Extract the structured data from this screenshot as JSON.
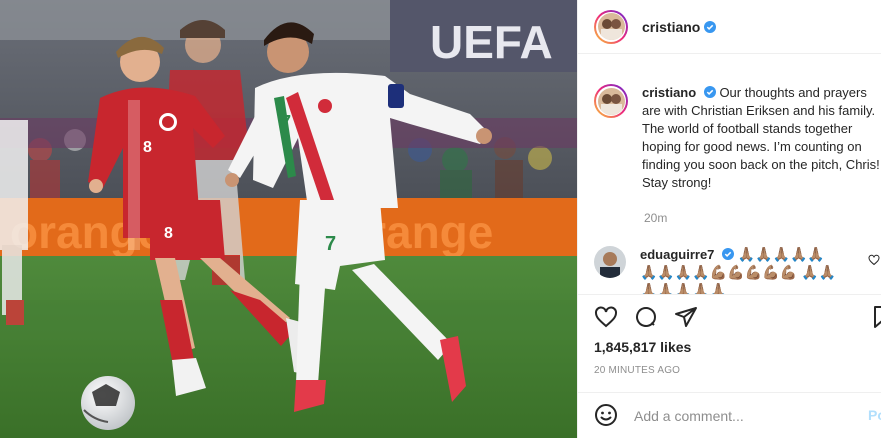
{
  "post": {
    "photo_alt": "Cristiano Ronaldo dribbling past Christian Eriksen",
    "banner_text": "UEFA",
    "ad_board_text": "orange",
    "jersey_numbers": {
      "player_left": "8",
      "player_right": "7"
    }
  },
  "header": {
    "username": "cristiano",
    "verified": true
  },
  "caption": {
    "username": "cristiano",
    "text": "Our thoughts and prayers are with Christian Eriksen and his family. The world of football stands together hoping for good news. I’m counting on finding you soon back on the pitch, Chris! Stay strong!",
    "time": "20m"
  },
  "comments": [
    {
      "username": "eduaguirre7",
      "verified": true,
      "text": "🙏🏽🙏🏽🙏🏽🙏🏽🙏🏽 🙏🏽🙏🏽🙏🏽🙏🏽💪🏽💪🏽💪🏽💪🏽💪🏽 🙏🏽🙏🏽🙏🏽🙏🏽🙏🏽🙏🏽🙏🏽"
    }
  ],
  "actions": {
    "like_icon": "heart-icon",
    "comment_icon": "comment-icon",
    "share_icon": "share-icon",
    "save_icon": "bookmark-icon"
  },
  "likes": "1,845,817 likes",
  "posted_time": "20 MINUTES AGO",
  "add_comment": {
    "placeholder": "Add a comment...",
    "post_label": "Po"
  },
  "colors": {
    "verified_blue": "#3897f0",
    "text": "#262626",
    "muted": "#8e8e8e",
    "divider": "#efefef",
    "post_button": "#b2dffc"
  }
}
